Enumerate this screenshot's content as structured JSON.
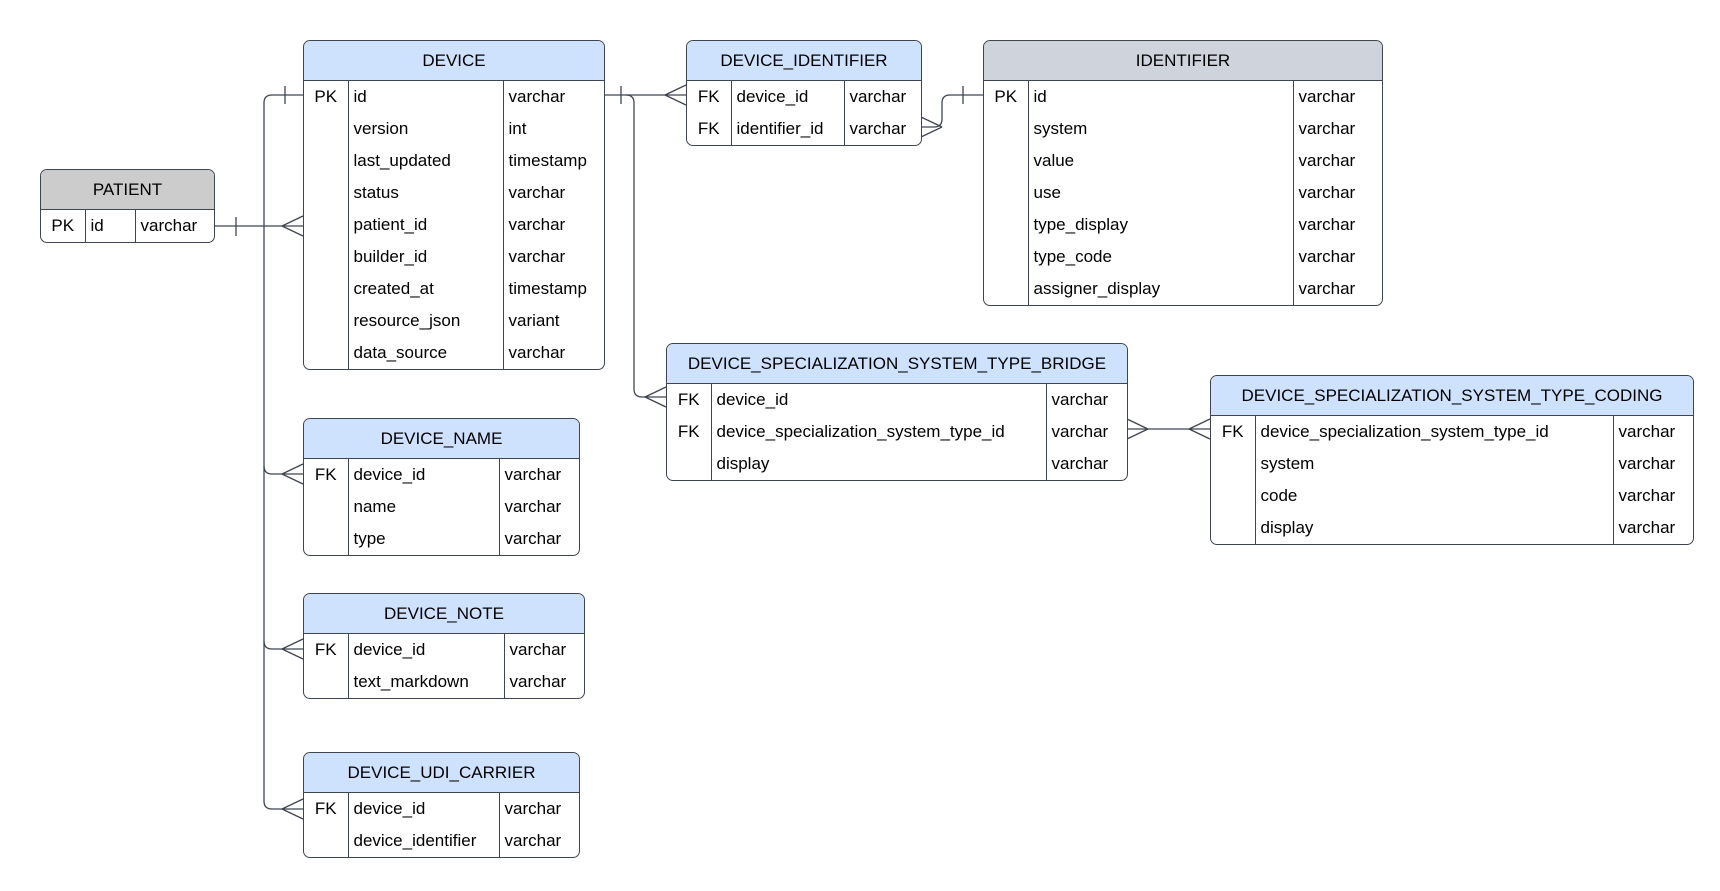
{
  "diagram": {
    "type": "entity-relationship",
    "entities": {
      "patient": {
        "name": "PATIENT",
        "header_color": "#cccccc",
        "columns": [
          {
            "key": "PK",
            "name": "id",
            "type": "varchar"
          }
        ]
      },
      "device": {
        "name": "DEVICE",
        "header_color": "#cfe2fd",
        "columns": [
          {
            "key": "PK",
            "name": "id",
            "type": "varchar"
          },
          {
            "key": "",
            "name": "version",
            "type": "int"
          },
          {
            "key": "",
            "name": "last_updated",
            "type": "timestamp"
          },
          {
            "key": "",
            "name": "status",
            "type": "varchar"
          },
          {
            "key": "",
            "name": "patient_id",
            "type": "varchar"
          },
          {
            "key": "",
            "name": "builder_id",
            "type": "varchar"
          },
          {
            "key": "",
            "name": "created_at",
            "type": "timestamp"
          },
          {
            "key": "",
            "name": "resource_json",
            "type": "variant"
          },
          {
            "key": "",
            "name": "data_source",
            "type": "varchar"
          }
        ]
      },
      "device_identifier": {
        "name": "DEVICE_IDENTIFIER",
        "header_color": "#cfe2fd",
        "columns": [
          {
            "key": "FK",
            "name": "device_id",
            "type": "varchar"
          },
          {
            "key": "FK",
            "name": "identifier_id",
            "type": "varchar"
          }
        ]
      },
      "identifier": {
        "name": "IDENTIFIER",
        "header_color": "#cfd4dc",
        "columns": [
          {
            "key": "PK",
            "name": "id",
            "type": "varchar"
          },
          {
            "key": "",
            "name": "system",
            "type": "varchar"
          },
          {
            "key": "",
            "name": "value",
            "type": "varchar"
          },
          {
            "key": "",
            "name": "use",
            "type": "varchar"
          },
          {
            "key": "",
            "name": "type_display",
            "type": "varchar"
          },
          {
            "key": "",
            "name": "type_code",
            "type": "varchar"
          },
          {
            "key": "",
            "name": "assigner_display",
            "type": "varchar"
          }
        ]
      },
      "bridge": {
        "name": "DEVICE_SPECIALIZATION_SYSTEM_TYPE_BRIDGE",
        "header_color": "#cfe2fd",
        "columns": [
          {
            "key": "FK",
            "name": "device_id",
            "type": "varchar"
          },
          {
            "key": "FK",
            "name": "device_specialization_system_type_id",
            "type": "varchar"
          },
          {
            "key": "",
            "name": "display",
            "type": "varchar"
          }
        ]
      },
      "coding": {
        "name": "DEVICE_SPECIALIZATION_SYSTEM_TYPE_CODING",
        "header_color": "#cfe2fd",
        "columns": [
          {
            "key": "FK",
            "name": "device_specialization_system_type_id",
            "type": "varchar"
          },
          {
            "key": "",
            "name": "system",
            "type": "varchar"
          },
          {
            "key": "",
            "name": "code",
            "type": "varchar"
          },
          {
            "key": "",
            "name": "display",
            "type": "varchar"
          }
        ]
      },
      "device_name": {
        "name": "DEVICE_NAME",
        "header_color": "#cfe2fd",
        "columns": [
          {
            "key": "FK",
            "name": "device_id",
            "type": "varchar"
          },
          {
            "key": "",
            "name": "name",
            "type": "varchar"
          },
          {
            "key": "",
            "name": "type",
            "type": "varchar"
          }
        ]
      },
      "device_note": {
        "name": "DEVICE_NOTE",
        "header_color": "#cfe2fd",
        "columns": [
          {
            "key": "FK",
            "name": "device_id",
            "type": "varchar"
          },
          {
            "key": "",
            "name": "text_markdown",
            "type": "varchar"
          }
        ]
      },
      "device_udi_carrier": {
        "name": "DEVICE_UDI_CARRIER",
        "header_color": "#cfe2fd",
        "columns": [
          {
            "key": "FK",
            "name": "device_id",
            "type": "varchar"
          },
          {
            "key": "",
            "name": "device_identifier",
            "type": "varchar"
          }
        ]
      }
    },
    "relationships": [
      {
        "from": "PATIENT.id",
        "to": "DEVICE.patient_id",
        "cardinality": "one-to-many"
      },
      {
        "from": "DEVICE.id",
        "to": "DEVICE_IDENTIFIER.device_id",
        "cardinality": "one-to-many"
      },
      {
        "from": "IDENTIFIER.id",
        "to": "DEVICE_IDENTIFIER.identifier_id",
        "cardinality": "one-to-many"
      },
      {
        "from": "DEVICE.id",
        "to": "DEVICE_SPECIALIZATION_SYSTEM_TYPE_BRIDGE.device_id",
        "cardinality": "one-to-many"
      },
      {
        "from": "DEVICE_SPECIALIZATION_SYSTEM_TYPE_BRIDGE.device_specialization_system_type_id",
        "to": "DEVICE_SPECIALIZATION_SYSTEM_TYPE_CODING.device_specialization_system_type_id",
        "cardinality": "many-to-many"
      },
      {
        "from": "DEVICE.id",
        "to": "DEVICE_NAME.device_id",
        "cardinality": "one-to-many"
      },
      {
        "from": "DEVICE.id",
        "to": "DEVICE_NOTE.device_id",
        "cardinality": "one-to-many"
      },
      {
        "from": "DEVICE.id",
        "to": "DEVICE_UDI_CARRIER.device_id",
        "cardinality": "one-to-many"
      }
    ]
  }
}
